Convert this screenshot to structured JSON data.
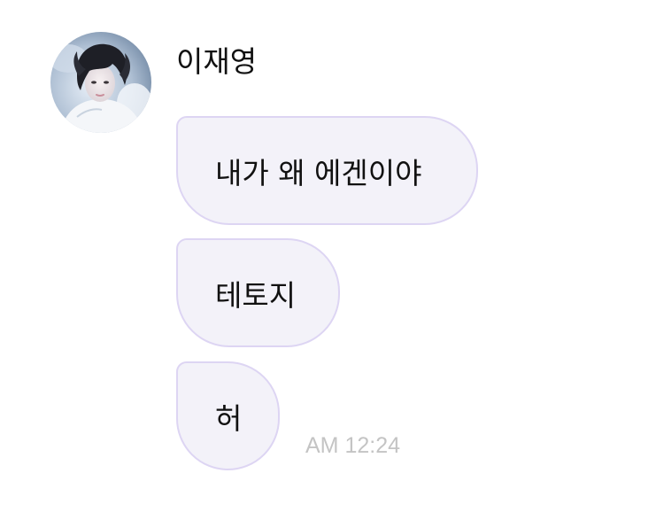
{
  "message_group": {
    "sender": {
      "name": "이재영",
      "avatar_icon": "profile-photo-avatar"
    },
    "messages": [
      {
        "text": "내가 왜 에겐이야"
      },
      {
        "text": "테토지"
      },
      {
        "text": "허"
      }
    ],
    "timestamp": "AM 12:24"
  },
  "colors": {
    "bubble_fill": "#f3f2f9",
    "bubble_border": "#ddd5f3",
    "text": "#111111",
    "timestamp": "#c4c4c4"
  }
}
